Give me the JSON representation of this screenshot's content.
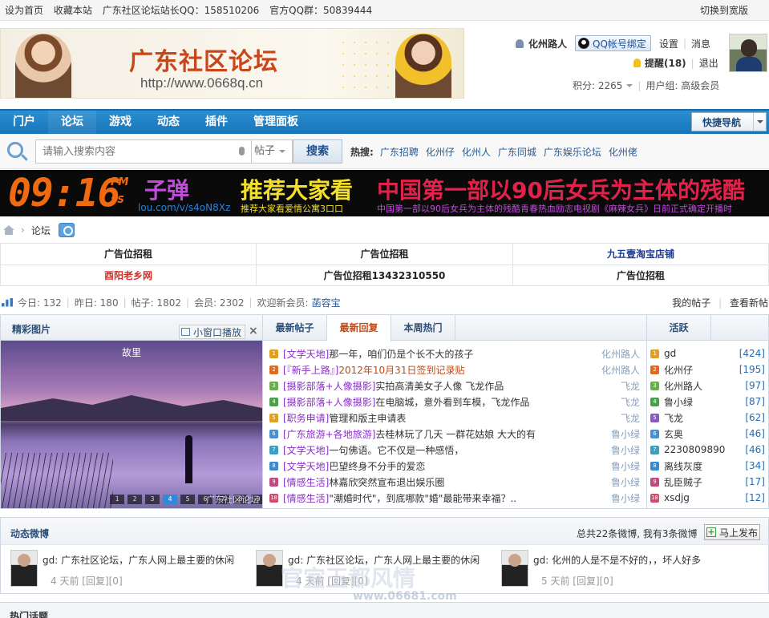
{
  "topbar": {
    "links": [
      "设为首页",
      "收藏本站",
      "广东社区论坛站长QQ：158510206",
      "官方QQ群：50839444"
    ],
    "right": "切换到宽版"
  },
  "header": {
    "site_title": "广东社区论坛",
    "site_url": "http://www.0668q.cn"
  },
  "user": {
    "name": "化州路人",
    "qq_bind": "QQ帐号绑定",
    "settings": "设置",
    "messages": "消息",
    "remind": "提醒(18)",
    "logout": "退出",
    "points": "积分: 2265",
    "group": "用户组: 高级会员"
  },
  "nav": {
    "items": [
      "门户",
      "论坛",
      "游戏",
      "动态",
      "插件",
      "管理面板"
    ],
    "active": "论坛",
    "quick_nav": "快捷导航"
  },
  "search": {
    "placeholder": "请输入搜索内容",
    "type": "帖子",
    "button": "搜索",
    "hot_label": "热搜:",
    "hot_words": [
      "广东招聘",
      "化州仔",
      "化州人",
      "广东同城",
      "广东娱乐论坛",
      "化州佬"
    ]
  },
  "led_banner": {
    "clock": "09:16",
    "am_pm": "PM",
    "ss": "SS",
    "text1": "子弹",
    "text1_sub": "lou.com/v/s4oN8Xz",
    "text2": "推荐大家看",
    "text2_sub": "推荐大家看爱情公寓3口口",
    "text3": "中国第一部以90后女兵为主体的残酷",
    "text3_sub": "中国第一部以90后女兵为主体的残酷青春热血励志电视剧《麻辣女兵》日前正式确定开播时"
  },
  "breadcrumb": {
    "label": "论坛"
  },
  "ads": [
    {
      "text": "广告位招租",
      "color": "#222"
    },
    {
      "text": "广告位招租",
      "color": "#222"
    },
    {
      "text": "九五壹淘宝店铺",
      "color": "#1a3c9a"
    },
    {
      "text": "酉阳老乡网",
      "color": "#d0302a"
    },
    {
      "text": "广告位招租13432310550",
      "color": "#222"
    },
    {
      "text": "广告位招租",
      "color": "#222"
    }
  ],
  "stats": {
    "today": "今日: 132",
    "yesterday": "昨日: 180",
    "posts": "帖子: 1802",
    "members": "会员: 2302",
    "welcome": "欢迎新会员:",
    "new_member": "菡容宝",
    "my_posts": "我的帖子",
    "view_new": "查看新帖"
  },
  "pictures": {
    "title": "精彩图片",
    "popup": "小窗口播放",
    "close": "×",
    "caption": "故里",
    "pages": [
      "1",
      "2",
      "3",
      "4",
      "5",
      "6",
      "7",
      "8",
      "9",
      "10"
    ],
    "current_page": "4",
    "watermark": "广东社区论坛"
  },
  "threads": {
    "tabs": [
      "最新帖子",
      "最新回复",
      "本周热门"
    ],
    "active_tab": "最新回复",
    "items": [
      {
        "cat": "[文学天地]",
        "subject": "那一年，咱们仍是个长不大的孩子",
        "author": "化州路人",
        "icon_color": "#e0a020",
        "subject_color": "#333"
      },
      {
        "cat": "[『新手上路』]",
        "subject": "2012年10月31日签到记录贴",
        "author": "化州路人",
        "icon_color": "#e06a20",
        "subject_color": "#c44a12"
      },
      {
        "cat": "[摄影部落+人像摄影]",
        "subject": "实拍高清美女子人像 飞龙作品",
        "author": "飞龙",
        "icon_color": "#6ab04a",
        "subject_color": "#333"
      },
      {
        "cat": "[摄影部落+人像摄影]",
        "subject": "在电脑城，意外看到车模，飞龙作品",
        "author": "飞龙",
        "icon_color": "#4aa04a",
        "subject_color": "#333"
      },
      {
        "cat": "[职务申请]",
        "subject": "管理和版主申请表",
        "author": "飞龙",
        "icon_color": "#e0a020",
        "subject_color": "#333"
      },
      {
        "cat": "[广东旅游+各地旅游]",
        "subject": "去桂林玩了几天 一群花姑娘 大大的有",
        "author": "鲁小绿",
        "icon_color": "#4a90d0",
        "subject_color": "#333"
      },
      {
        "cat": "[文学天地]",
        "subject": "一句佛语。它不仅是一种感悟，",
        "author": "鲁小绿",
        "icon_color": "#3aa0c0",
        "subject_color": "#333"
      },
      {
        "cat": "[文学天地]",
        "subject": "巴望终身不分手的爱恋",
        "author": "鲁小绿",
        "icon_color": "#3a8ad0",
        "subject_color": "#333"
      },
      {
        "cat": "[情感生活]",
        "subject": "林嘉欣突然宣布退出娱乐圈",
        "author": "鲁小绿",
        "icon_color": "#c04a80",
        "subject_color": "#333"
      },
      {
        "cat": "[情感生活]",
        "subject": "\"潮婚时代\"，到底哪款\"婚\"最能带来幸福？..",
        "author": "鲁小绿",
        "icon_color": "#d04a6a",
        "subject_color": "#333"
      }
    ]
  },
  "active": {
    "title": "活跃",
    "items": [
      {
        "name": "gd",
        "count": "[424]",
        "icon_color": "#e0a020"
      },
      {
        "name": "化州仔",
        "count": "[195]",
        "icon_color": "#e06a20"
      },
      {
        "name": "化州路人",
        "count": "[97]",
        "icon_color": "#6ab04a"
      },
      {
        "name": "鲁小绿",
        "count": "[87]",
        "icon_color": "#4aa04a"
      },
      {
        "name": "飞龙",
        "count": "[62]",
        "icon_color": "#8a5ac0"
      },
      {
        "name": "玄奥",
        "count": "[46]",
        "icon_color": "#4a90d0"
      },
      {
        "name": "2230809890",
        "count": "[46]",
        "icon_color": "#3aa0c0"
      },
      {
        "name": "离线灰度",
        "count": "[34]",
        "icon_color": "#3a8ad0"
      },
      {
        "name": "乱臣贼子",
        "count": "[17]",
        "icon_color": "#c04a80"
      },
      {
        "name": "xsdjg",
        "count": "[12]",
        "icon_color": "#d04a6a"
      }
    ]
  },
  "weibo": {
    "title": "动态微博",
    "count": "总共22条微博, 我有3条微博",
    "publish": "马上发布",
    "items": [
      {
        "text": "gd: 广东社区论坛，广东人网上最主要的休闲",
        "meta": "4 天前 [回复][0]"
      },
      {
        "text": "gd: 广东社区论坛，广东人网上最主要的休闲",
        "meta": "4 天前 [回复][0]"
      },
      {
        "text": "gd: 化州的人是不是不好的，，坏人好多",
        "meta": "5 天前 [回复][0]"
      }
    ]
  },
  "watermark": {
    "text": "官宜玉都风情",
    "url": "www.06681.com"
  },
  "hot_topics": {
    "title": "热门话题"
  }
}
